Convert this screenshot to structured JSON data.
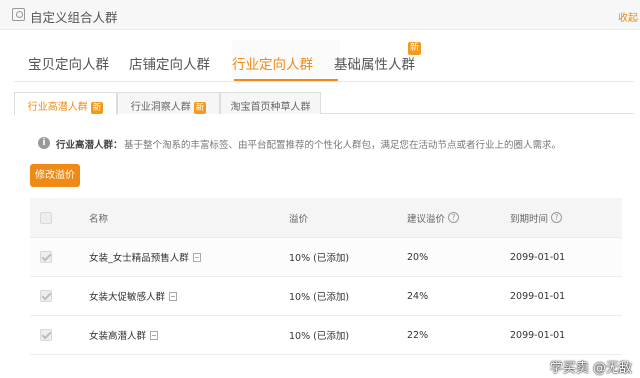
{
  "header": {
    "title": "自定义组合人群",
    "right_link": "收起"
  },
  "main_tabs": [
    {
      "label": "宝贝定向人群",
      "active": false
    },
    {
      "label": "店铺定向人群",
      "active": false
    },
    {
      "label": "行业定向人群",
      "active": true
    },
    {
      "label": "基础属性人群",
      "active": false,
      "badge": "新"
    }
  ],
  "sub_tabs": [
    {
      "label": "行业高潜人群",
      "active": true,
      "badge": "新"
    },
    {
      "label": "行业洞察人群",
      "active": false,
      "badge": "新"
    },
    {
      "label": "淘宝首页种草人群",
      "active": false
    }
  ],
  "info": {
    "icon": "info-icon",
    "label": "行业高潜人群：",
    "text": "基于整个淘系的丰富标签、由平台配置推荐的个性化人群包，满足您在活动节点或者行业上的圈人需求。"
  },
  "actions": {
    "modify_label": "修改溢价"
  },
  "table": {
    "columns": [
      "名称",
      "溢价",
      "建议溢价",
      "到期时间"
    ],
    "rows": [
      {
        "name": "女装_女士精品预售人群",
        "premium": "10% (已添加)",
        "suggested": "20%",
        "expiry": "2099-01-01"
      },
      {
        "name": "女装大促敏感人群",
        "premium": "10% (已添加)",
        "suggested": "24%",
        "expiry": "2099-01-01"
      },
      {
        "name": "女装高潜人群",
        "premium": "10% (已添加)",
        "suggested": "22%",
        "expiry": "2099-01-01"
      }
    ]
  },
  "watermark": "学买卖 @无敌",
  "colors": {
    "accent": "#f08a17",
    "badge": "#f39a1d"
  }
}
